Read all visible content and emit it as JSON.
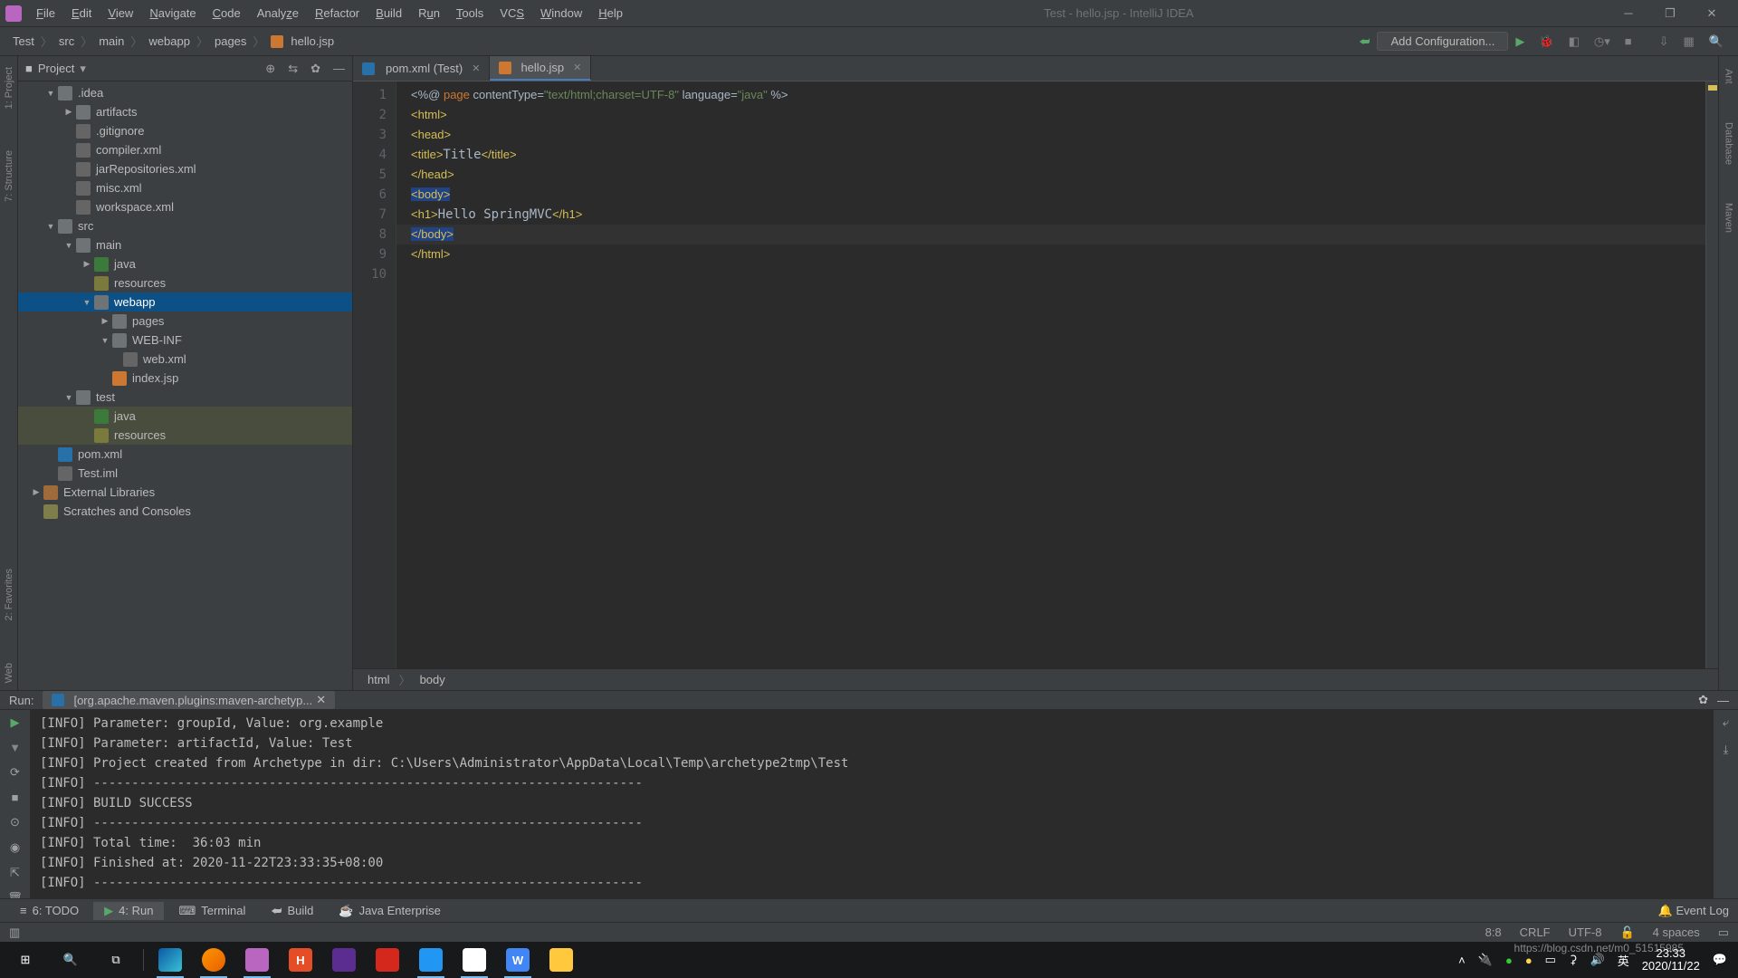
{
  "titlebar": {
    "title": "Test - hello.jsp - IntelliJ IDEA",
    "menus": [
      "File",
      "Edit",
      "View",
      "Navigate",
      "Code",
      "Analyze",
      "Refactor",
      "Build",
      "Run",
      "Tools",
      "VCS",
      "Window",
      "Help"
    ]
  },
  "breadcrumb": [
    "Test",
    "src",
    "main",
    "webapp",
    "pages",
    "hello.jsp"
  ],
  "toolbar_right": {
    "add_config": "Add Configuration..."
  },
  "project_header": "Project",
  "tree": {
    "n0": ".idea",
    "n1": "artifacts",
    "n2": ".gitignore",
    "n3": "compiler.xml",
    "n4": "jarRepositories.xml",
    "n5": "misc.xml",
    "n6": "workspace.xml",
    "n7": "src",
    "n8": "main",
    "n9": "java",
    "n10": "resources",
    "n11": "webapp",
    "n12": "pages",
    "n13": "WEB-INF",
    "n14": "web.xml",
    "n15": "index.jsp",
    "n16": "test",
    "n17": "java",
    "n18": "resources",
    "n19": "pom.xml",
    "n20": "Test.iml",
    "n21": "External Libraries",
    "n22": "Scratches and Consoles"
  },
  "tabs": [
    {
      "label": "pom.xml (Test)",
      "active": false
    },
    {
      "label": "hello.jsp",
      "active": true
    }
  ],
  "code_lines": [
    "<%@ page contentType=\"text/html;charset=UTF-8\" language=\"java\" %>",
    "<html>",
    "<head>",
    "    <title>Title</title>",
    "</head>",
    "<body>",
    "<h1>Hello SpringMVC</h1>",
    "</body>",
    "</html>",
    ""
  ],
  "ed_breadcrumb": [
    "html",
    "body"
  ],
  "left_tools": [
    "1: Project",
    "7: Structure"
  ],
  "left_tools2": [
    "2: Favorites",
    "Web"
  ],
  "right_tools": [
    "Ant",
    "Database",
    "Maven"
  ],
  "run": {
    "label": "Run:",
    "tab": "[org.apache.maven.plugins:maven-archetyp...",
    "lines": [
      "[INFO] Parameter: groupId, Value: org.example",
      "[INFO] Parameter: artifactId, Value: Test",
      "[INFO] Project created from Archetype in dir: C:\\Users\\Administrator\\AppData\\Local\\Temp\\archetype2tmp\\Test",
      "[INFO] ------------------------------------------------------------------------",
      "[INFO] BUILD SUCCESS",
      "[INFO] ------------------------------------------------------------------------",
      "[INFO] Total time:  36:03 min",
      "[INFO] Finished at: 2020-11-22T23:33:35+08:00",
      "[INFO] ------------------------------------------------------------------------"
    ]
  },
  "bottom_tabs": {
    "todo": "6: TODO",
    "run": "4: Run",
    "terminal": "Terminal",
    "build": "Build",
    "je": "Java Enterprise",
    "eventlog": "Event Log"
  },
  "status": {
    "pos": "8:8",
    "le": "CRLF",
    "enc": "UTF-8",
    "indent": "4 spaces"
  },
  "taskbar": {
    "time": "23:33",
    "date": "2020/11/22",
    "lang": "英",
    "watermark": "https://blog.csdn.net/m0_51515985"
  }
}
